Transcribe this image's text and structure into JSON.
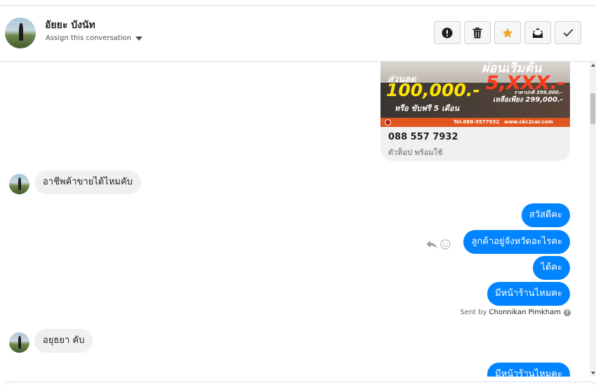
{
  "header": {
    "contact_name": "อัยยะ บังนัท",
    "assign_label": "Assign this conversation",
    "actions": [
      {
        "name": "spam-button",
        "icon": "exclamation-icon"
      },
      {
        "name": "delete-button",
        "icon": "trash-icon"
      },
      {
        "name": "star-button",
        "icon": "star-icon",
        "color": "#f5a623"
      },
      {
        "name": "mark-unread-button",
        "icon": "envelope-icon"
      },
      {
        "name": "mark-done-button",
        "icon": "check-icon"
      }
    ]
  },
  "card": {
    "ad_discount_label": "ส่วนลด",
    "ad_discount_value": "100,000.-",
    "ad_free_line": "หรือ ขับฟรี 5 เดือน",
    "ad_install_label": "ผ่อนเริ่มต้น",
    "ad_install_value": "5,XXX.-",
    "ad_price_normal": "ราคาปกติ 399,000.-",
    "ad_price_now": "เหลือเพียง 299,000.-",
    "ad_phone": "Tel.088-5577932",
    "ad_site": "www.ckc2car.com",
    "phone": "088 557 7932",
    "subtitle": "ตัวท็อป พร้อมใช้"
  },
  "messages": [
    {
      "direction": "in",
      "text": "อาชีพค้าขายได้ไหมคับ"
    },
    {
      "direction": "out",
      "text": "สวัสดีคะ"
    },
    {
      "direction": "out",
      "text": "ลูกค้าอยู่จังหวัดอะไรคะ"
    },
    {
      "direction": "out",
      "text": "ได้คะ"
    },
    {
      "direction": "out",
      "text": "มีหน้าร้านไหมคะ"
    },
    {
      "direction": "in",
      "text": "อยุธยา คับ"
    },
    {
      "direction": "out",
      "text": "มีหน้าร้านไหมคะ"
    }
  ],
  "sent_by": {
    "prefix": "Sent by",
    "name": "Chonnikan Pimkham",
    "help": "?"
  },
  "colors": {
    "outgoing_bubble": "#0084ff",
    "incoming_bubble": "#f1f0f0",
    "star": "#f5a623"
  }
}
